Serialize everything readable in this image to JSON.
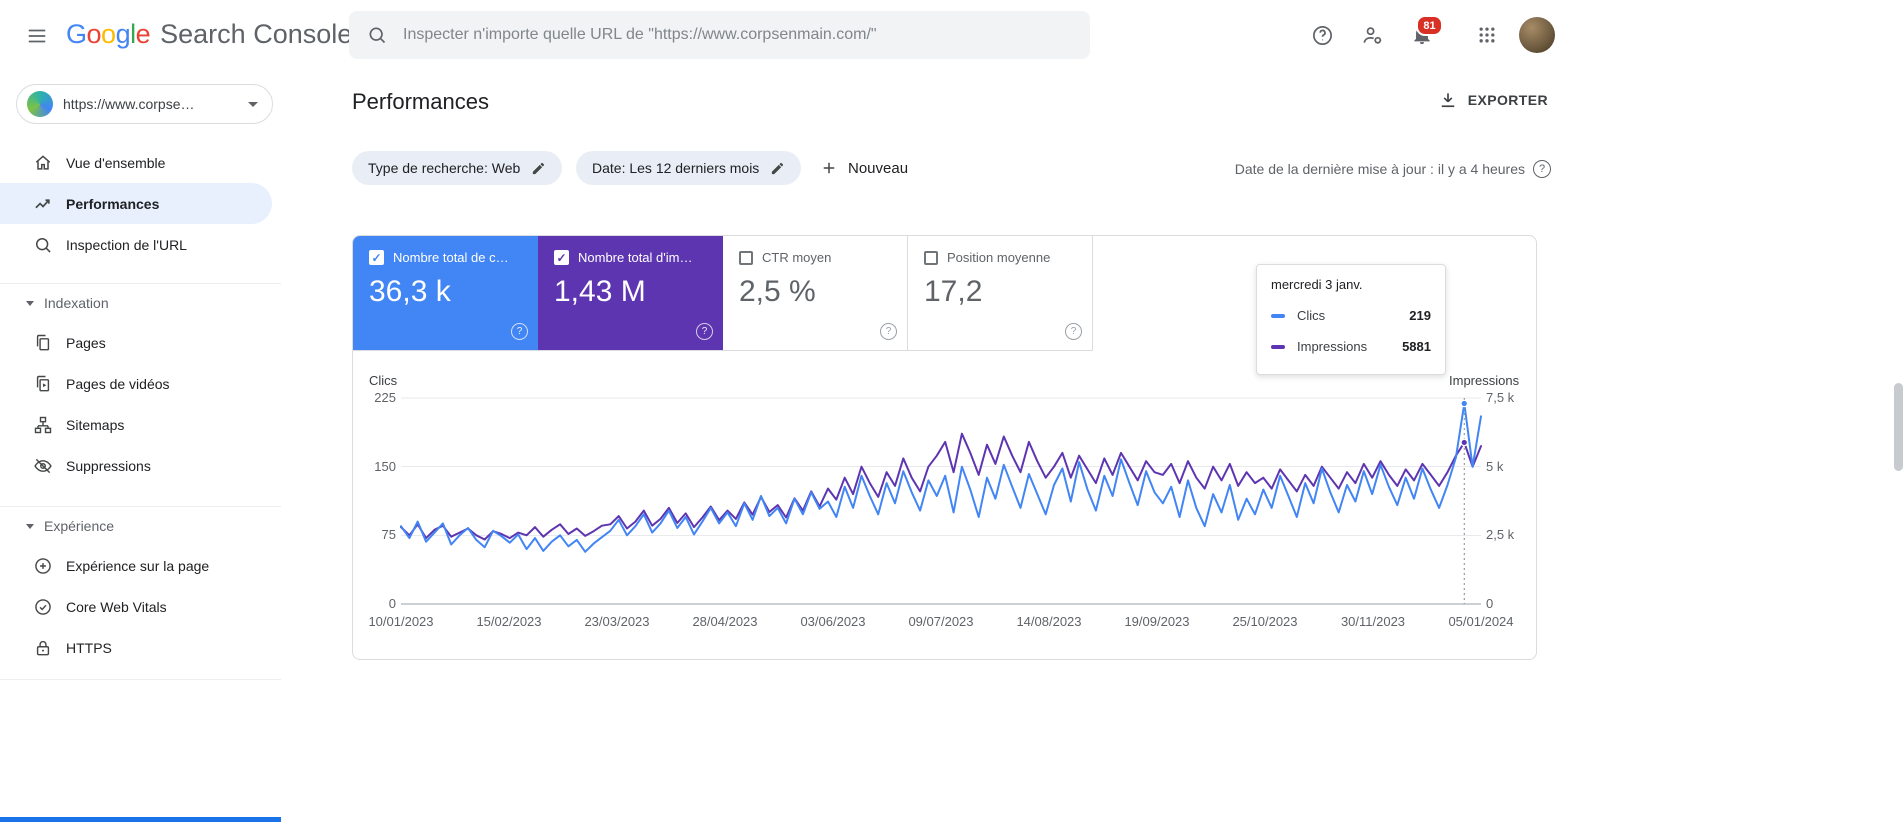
{
  "colors": {
    "accent_blue": "#1a73e8",
    "clicks_series": "#4285f4",
    "impressions_series": "#5e35b1",
    "notification_badge": "#d93025",
    "selected_nav_background": "#e8f0fe"
  },
  "topbar": {
    "brand": {
      "letters": [
        "G",
        "o",
        "o",
        "g",
        "l",
        "e"
      ],
      "suite": "Search Console"
    },
    "search_placeholder": "Inspecter n'importe quelle URL de \"https://www.corpsenmain.com/\"",
    "notification_count": "81"
  },
  "sidebar": {
    "property_label": "https://www.corpse…",
    "items": [
      {
        "label": "Vue d'ensemble"
      },
      {
        "label": "Performances",
        "selected": true
      },
      {
        "label": "Inspection de l'URL"
      }
    ],
    "sections": [
      {
        "label": "Indexation",
        "items": [
          {
            "label": "Pages"
          },
          {
            "label": "Pages de vidéos"
          },
          {
            "label": "Sitemaps"
          },
          {
            "label": "Suppressions"
          }
        ]
      },
      {
        "label": "Expérience",
        "items": [
          {
            "label": "Expérience sur la page"
          },
          {
            "label": "Core Web Vitals"
          },
          {
            "label": "HTTPS"
          }
        ]
      }
    ]
  },
  "main": {
    "title": "Performances",
    "export_label": "EXPORTER",
    "filters": [
      {
        "label": "Type de recherche: Web"
      },
      {
        "label": "Date: Les 12 derniers mois"
      }
    ],
    "new_filter_label": "Nouveau",
    "last_update": "Date de la dernière mise à jour : il y a 4 heures",
    "metrics": [
      {
        "label": "Nombre total de c…",
        "value": "36,3 k",
        "selected": true,
        "color": "#4285f4"
      },
      {
        "label": "Nombre total d'im…",
        "value": "1,43 M",
        "selected": true,
        "color": "#5e35b1"
      },
      {
        "label": "CTR moyen",
        "value": "2,5 %",
        "selected": false
      },
      {
        "label": "Position moyenne",
        "value": "17,2",
        "selected": false
      }
    ],
    "tooltip": {
      "title": "mercredi 3 janv.",
      "rows": [
        {
          "label": "Clics",
          "value": "219",
          "color": "#4285f4"
        },
        {
          "label": "Impressions",
          "value": "5881",
          "color": "#5e35b1"
        }
      ]
    }
  },
  "chart_data": {
    "type": "line",
    "x_tick_labels": [
      "10/01/2023",
      "15/02/2023",
      "23/03/2023",
      "28/04/2023",
      "03/06/2023",
      "09/07/2023",
      "14/08/2023",
      "19/09/2023",
      "25/10/2023",
      "30/11/2023",
      "05/01/2024"
    ],
    "left_axis": {
      "label": "Clics",
      "max": 225,
      "ticks": [
        0,
        75,
        150,
        225
      ],
      "tick_labels": [
        "225",
        "150",
        "75",
        "0"
      ]
    },
    "right_axis": {
      "label": "Impressions",
      "max": 7500,
      "tick_labels": [
        "7,5 k",
        "5 k",
        "2,5 k",
        "0"
      ]
    },
    "grid": true,
    "legend_position": "none",
    "hover_index": 127,
    "series": [
      {
        "name": "Clics",
        "color": "#4285f4",
        "axis": "left",
        "values": [
          85,
          72,
          90,
          68,
          78,
          88,
          65,
          75,
          83,
          70,
          62,
          80,
          74,
          67,
          76,
          60,
          72,
          58,
          68,
          75,
          63,
          70,
          57,
          66,
          73,
          80,
          92,
          75,
          85,
          98,
          78,
          88,
          102,
          83,
          95,
          76,
          90,
          105,
          88,
          100,
          85,
          110,
          92,
          118,
          96,
          105,
          88,
          115,
          98,
          122,
          104,
          112,
          95,
          128,
          105,
          140,
          118,
          98,
          132,
          110,
          145,
          122,
          102,
          135,
          118,
          140,
          100,
          150,
          125,
          95,
          138,
          115,
          152,
          128,
          105,
          142,
          120,
          98,
          130,
          148,
          112,
          155,
          125,
          102,
          140,
          118,
          158,
          132,
          108,
          145,
          122,
          110,
          128,
          95,
          135,
          105,
          85,
          120,
          100,
          130,
          92,
          115,
          98,
          125,
          105,
          140,
          118,
          95,
          132,
          110,
          148,
          122,
          100,
          130,
          112,
          145,
          120,
          152,
          128,
          108,
          138,
          115,
          148,
          125,
          105,
          130,
          160,
          219,
          150,
          205
        ]
      },
      {
        "name": "Impressions",
        "color": "#5e35b1",
        "axis": "right",
        "values": [
          2800,
          2500,
          2900,
          2400,
          2700,
          2850,
          2450,
          2600,
          2750,
          2500,
          2350,
          2650,
          2550,
          2400,
          2600,
          2500,
          2800,
          2450,
          2700,
          2900,
          2550,
          2750,
          2480,
          2650,
          2850,
          2900,
          3200,
          2750,
          3000,
          3400,
          2850,
          3100,
          3500,
          2950,
          3300,
          2800,
          3150,
          3550,
          3050,
          3400,
          3100,
          3700,
          3250,
          3900,
          3350,
          3600,
          3150,
          3850,
          3400,
          4100,
          3550,
          4200,
          3800,
          4600,
          4000,
          5000,
          4400,
          3900,
          4800,
          4300,
          5300,
          4600,
          4100,
          5000,
          5400,
          5900,
          4800,
          6200,
          5500,
          4700,
          5800,
          5100,
          6100,
          5400,
          4800,
          5900,
          5200,
          4600,
          5000,
          5500,
          4600,
          5400,
          4900,
          4400,
          5300,
          4700,
          5500,
          5000,
          4500,
          5200,
          4800,
          4700,
          5100,
          4400,
          5200,
          4600,
          4200,
          5000,
          4500,
          5100,
          4300,
          4800,
          4400,
          4600,
          4200,
          4900,
          4500,
          4100,
          4700,
          4300,
          5000,
          4600,
          4200,
          4800,
          4400,
          5100,
          4600,
          5200,
          4700,
          4300,
          4900,
          4500,
          5100,
          4700,
          4300,
          4800,
          5400,
          5881,
          5000,
          5750
        ]
      }
    ]
  }
}
